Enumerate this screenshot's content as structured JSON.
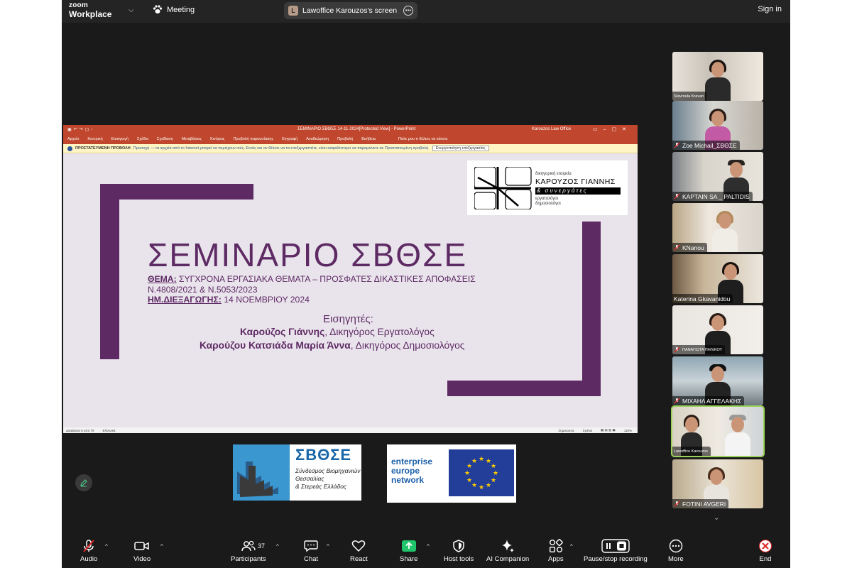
{
  "topbar": {
    "logo_line1": "zoom",
    "logo_line2": "Workplace",
    "meeting_label": "Meeting",
    "share_badge": "L",
    "share_label": "Lawoffice Karouzos's screen",
    "signin_label": "Sign in"
  },
  "ppt": {
    "titlebar": "ΣΕΜΙΝΑΡΙΟ ΣΒΘΣΕ 14-11-2024[Protected View]  -  PowerPoint",
    "account": "Karouzos Law Office",
    "menu": [
      "Αρχείο",
      "Κεντρική",
      "Εισαγωγή",
      "Σχέδιο",
      "Σχεδίαση",
      "Μεταβάσεις",
      "Κινήσεις",
      "Προβολή παρουσίασης",
      "Εγγραφή",
      "Αναθεώρηση",
      "Προβολή",
      "Βοήθεια"
    ],
    "menu_tell": "Πείτε μου τι θέλετε να κάνετε",
    "warn_label": "ΠΡΟΣΤΑΤΕΥΜΕΝΗ ΠΡΟΒΟΛΗ",
    "warn_msg": "Προσοχή — τα αρχεία από το Internet μπορεί να περιέχουν ιούς. Εκτός και αν θέλετε να τα επεξεργαστείτε, είναι ασφαλέστερο να παραμείνετε σε Προστατευμένη προβολή.",
    "warn_button": "Ενεργοποίηση επεξεργασίας",
    "status_left": "Διαφάνεια 6 από 79",
    "status_lang": "Ελληνικά",
    "status_notes": "Σημειώσεις",
    "status_comments": "Σχόλια",
    "zoom_level": "115%"
  },
  "slide": {
    "firm_small": "δικηγορική εταιρεία",
    "firm_name": "ΚΑΡΟΥΖΟΣ ΓΙΑΝΝΗΣ",
    "firm_partners": "& συνεργάτες",
    "firm_sub1": "εργατολόγοι",
    "firm_sub2": "δημοσιολόγοι",
    "title": "ΣΕΜΙΝΑΡΙΟ ΣΒΘΣΕ",
    "theme_label": "ΘΕΜΑ:",
    "theme_text": " ΣΥΓΧΡΟΝΑ ΕΡΓΑΣΙΑΚΑ ΘΕΜΑΤΑ – ΠΡΟΣΦΑΤΕΣ ΔΙΚΑΣΤΙΚΕΣ ΑΠΟΦΑΣΕΙΣ",
    "laws": "Ν.4808/2021 & Ν.5053/2023",
    "date_label": "ΗΜ.ΔΙΕΞΑΓΩΓΗΣ:",
    "date_text": " 14 ΝΟΕΜΒΡΙΟΥ 2024",
    "speakers_label": "Εισηγητές:",
    "speaker1_name": "Καρούζος Γιάννης",
    "speaker1_role": ", Δικηγόρος Εργατολόγος",
    "speaker2_name": "Καρούζου Κατσιάδα Μαρία Άννα",
    "speaker2_role": ", Δικηγόρος Δημοσιολόγος"
  },
  "footer_logos": {
    "sbose_name": "ΣΒΘΣΕ",
    "sbose_sub1": "Σύνδεσμος Βιομηχανιών",
    "sbose_sub2": "Θεσσαλίας",
    "sbose_sub3": "& Στερεάς Ελλάδος",
    "een_1": "enterprise",
    "een_2": "europe",
    "een_3": "network"
  },
  "gallery": [
    {
      "name": "Stavroula Kravari",
      "small": true,
      "muted": false
    },
    {
      "name": "Zoe Michail_ΣΒΘΣΕ",
      "small": false,
      "muted": true
    },
    {
      "name": "KAPTAIN SA _ PALTIDIS",
      "small": false,
      "muted": true
    },
    {
      "name": "KNanou",
      "small": false,
      "muted": true
    },
    {
      "name": "Katerina Gkavanidou",
      "small": false,
      "muted": false
    },
    {
      "name": "ΠΑΝΑΓΙΩΤΑ ΠΗΛΙΚΟΥ",
      "small": true,
      "muted": true
    },
    {
      "name": "ΜΙΧΑΗΛ ΑΓΓΕΛΑΚΗΣ",
      "small": false,
      "muted": true
    },
    {
      "name": "Lawoffice Karouzos",
      "small": true,
      "muted": false
    },
    {
      "name": "FOTINI AVGERI",
      "small": false,
      "muted": true
    }
  ],
  "toolbar": {
    "audio": "Audio",
    "video": "Video",
    "participants": "Participants",
    "participants_count": "37",
    "chat": "Chat",
    "react": "React",
    "share": "Share",
    "host_tools": "Host tools",
    "ai_companion": "AI Companion",
    "apps": "Apps",
    "recording": "Pause/stop recording",
    "more": "More",
    "end": "End"
  },
  "colors": {
    "slide_purple": "#5e2a64",
    "ppt_red": "#c0472d",
    "end_red": "#e02828",
    "share_green": "#1fc46b",
    "active_speaker": "#9bd35a"
  },
  "icons": [
    "zoom-logo",
    "paw-icon",
    "more-icon",
    "pen-icon",
    "mic-off-icon",
    "video-icon",
    "participants-icon",
    "chat-icon",
    "react-icon",
    "share-icon",
    "shield-icon",
    "sparkle-icon",
    "apps-icon",
    "record-icon",
    "more-dots-icon",
    "end-icon",
    "chevron-down-icon"
  ]
}
